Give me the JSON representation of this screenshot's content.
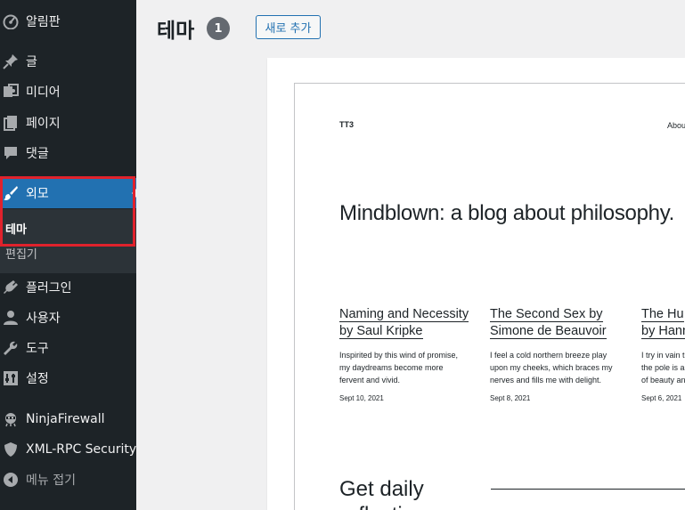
{
  "sidebar": {
    "items": [
      {
        "label": "알림판",
        "icon": "dashboard-icon"
      },
      {
        "label": "글",
        "icon": "pin-icon"
      },
      {
        "label": "미디어",
        "icon": "media-icon"
      },
      {
        "label": "페이지",
        "icon": "page-icon"
      },
      {
        "label": "댓글",
        "icon": "comment-icon"
      },
      {
        "label": "외모",
        "icon": "brush-icon"
      },
      {
        "label": "플러그인",
        "icon": "plugin-icon"
      },
      {
        "label": "사용자",
        "icon": "user-icon"
      },
      {
        "label": "도구",
        "icon": "wrench-icon"
      },
      {
        "label": "설정",
        "icon": "settings-icon"
      },
      {
        "label": "NinjaFirewall",
        "icon": "ninja-icon"
      },
      {
        "label": "XML-RPC Security",
        "icon": "shield-icon"
      },
      {
        "label": "메뉴 접기",
        "icon": "collapse-icon"
      }
    ],
    "submenu": {
      "theme": "테마",
      "editor": "편집기"
    }
  },
  "header": {
    "title": "테마",
    "count": "1",
    "add_new": "새로 추가"
  },
  "preview": {
    "site_title": "TT3",
    "nav": "About",
    "heading": "Mindblown: a blog about philosophy.",
    "posts": [
      {
        "title_line1": "Naming and Necessity",
        "title_line2": "by Saul Kripke",
        "excerpt_line1": "Inspirited by this wind of promise,",
        "excerpt_line2": "my daydreams become more",
        "excerpt_line3": "fervent and vivid.",
        "date": "Sept 10, 2021"
      },
      {
        "title_line1": "The Second Sex by",
        "title_line2": "Simone de Beauvoir",
        "excerpt_line1": "I feel a cold northern breeze play",
        "excerpt_line2": "upon my cheeks, which braces my",
        "excerpt_line3": "nerves and fills me with delight.",
        "date": "Sept 8, 2021"
      },
      {
        "title_line1": "The Hu",
        "title_line2": "by Hann",
        "excerpt_line1": "I try in vain t",
        "excerpt_line2": "the pole is a",
        "excerpt_line3": "of beauty an",
        "date": "Sept 6, 2021"
      }
    ],
    "daily_line1": "Get daily",
    "daily_line2": "reflectio"
  },
  "colors": {
    "sidebar_bg": "#1d2327",
    "active_bg": "#2271b1",
    "highlight": "#e0222c",
    "accent": "#2271b1"
  }
}
